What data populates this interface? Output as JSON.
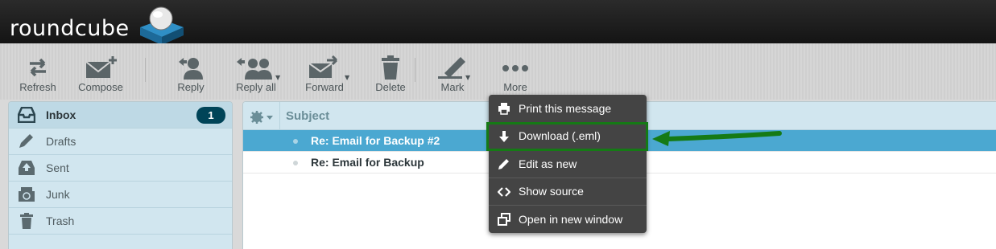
{
  "header": {
    "logo_text": "roundcube"
  },
  "toolbar": {
    "refresh": "Refresh",
    "compose": "Compose",
    "reply": "Reply",
    "reply_all": "Reply all",
    "forward": "Forward",
    "delete": "Delete",
    "mark": "Mark",
    "more": "More"
  },
  "folders": [
    {
      "label": "Inbox",
      "icon": "inbox-icon",
      "unread": "1"
    },
    {
      "label": "Drafts",
      "icon": "pencil-icon"
    },
    {
      "label": "Sent",
      "icon": "sent-icon"
    },
    {
      "label": "Junk",
      "icon": "recycle-icon"
    },
    {
      "label": "Trash",
      "icon": "trash-icon"
    }
  ],
  "message_list": {
    "subject_header": "Subject",
    "rows": [
      {
        "subject": "Re: Email for Backup #2",
        "selected": true
      },
      {
        "subject": "Re: Email for Backup",
        "selected": false
      }
    ]
  },
  "more_menu": {
    "items": [
      {
        "label": "Print this message",
        "icon": "print-icon"
      },
      {
        "label": "Download (.eml)",
        "icon": "download-icon"
      },
      {
        "label": "Edit as new",
        "icon": "pencil-icon"
      },
      {
        "label": "Show source",
        "icon": "code-icon"
      },
      {
        "label": "Open in new window",
        "icon": "new-window-icon"
      }
    ]
  },
  "colors": {
    "header_bg": "#1a1a1a",
    "selected_row": "#4ba8d1",
    "badge": "#004458",
    "annotation_green": "#157a15",
    "menu_bg": "#444444"
  }
}
